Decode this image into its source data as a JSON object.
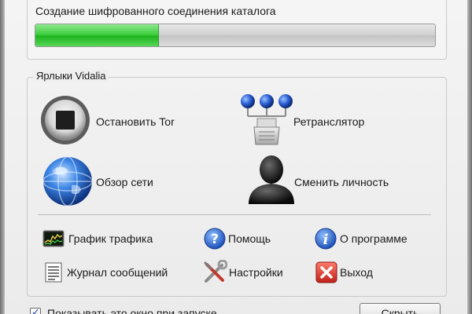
{
  "status": {
    "message": "Создание шифрованного соединения каталога",
    "progress_fraction": 0.31,
    "progress_color": "#2fc42f"
  },
  "shortcuts": {
    "title": "Ярлыки Vidalia",
    "large": [
      {
        "label": "Остановить Tor",
        "icon": "stop-icon"
      },
      {
        "label": "Ретранслятор",
        "icon": "relay-icon"
      },
      {
        "label": "Обзор сети",
        "icon": "globe-icon"
      },
      {
        "label": "Сменить личность",
        "icon": "identity-icon"
      }
    ],
    "small": [
      {
        "label": "График трафика",
        "icon": "bandwidth-graph-icon"
      },
      {
        "label": "Помощь",
        "icon": "help-icon"
      },
      {
        "label": "О программе",
        "icon": "info-icon"
      },
      {
        "label": "Журнал сообщений",
        "icon": "message-log-icon"
      },
      {
        "label": "Настройки",
        "icon": "settings-tools-icon"
      },
      {
        "label": "Выход",
        "icon": "exit-icon"
      }
    ]
  },
  "footer": {
    "show_on_startup_label": "Показывать это окно при запуске",
    "show_on_startup_checked": true,
    "hide_button": "Скрыть"
  }
}
